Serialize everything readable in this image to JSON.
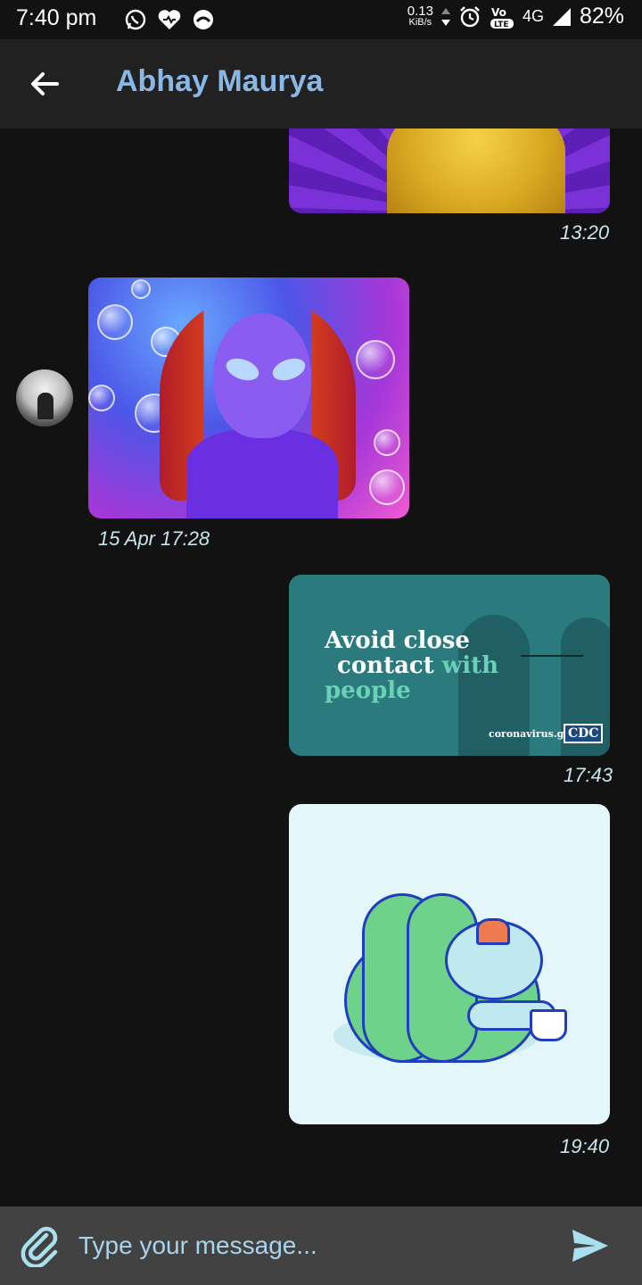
{
  "status_bar": {
    "time": "7:40 pm",
    "net_speed_value": "0.13",
    "net_speed_unit": "KiB/s",
    "network": "4G",
    "battery": "82%",
    "icons": [
      "whatsapp-icon",
      "heart-icon",
      "app-icon",
      "alarm-icon",
      "volte-icon",
      "signal-icon",
      "battery-icon"
    ]
  },
  "header": {
    "title": "Abhay Maurya",
    "back_icon": "arrow-left-icon"
  },
  "messages": [
    {
      "side": "right",
      "kind": "image",
      "time": "13:20"
    },
    {
      "side": "left",
      "kind": "image",
      "time": "15 Apr 17:28"
    },
    {
      "side": "right",
      "kind": "image",
      "time": "17:43",
      "image_text": {
        "line1": "Avoid close",
        "line2": "contact",
        "line2_accent": "with",
        "line3": "people",
        "url": "coronavirus.gov",
        "logo": "CDC"
      }
    },
    {
      "side": "right",
      "kind": "image",
      "time": "19:40"
    }
  ],
  "composer": {
    "placeholder": "Type your message...",
    "attach_icon": "paperclip-icon",
    "send_icon": "send-icon"
  },
  "colors": {
    "background": "#121212",
    "app_bar": "#212121",
    "title": "#8ab8e6",
    "timestamp": "#c8e4ec",
    "composer_bg": "#424242",
    "accent": "#a8e0f0"
  }
}
